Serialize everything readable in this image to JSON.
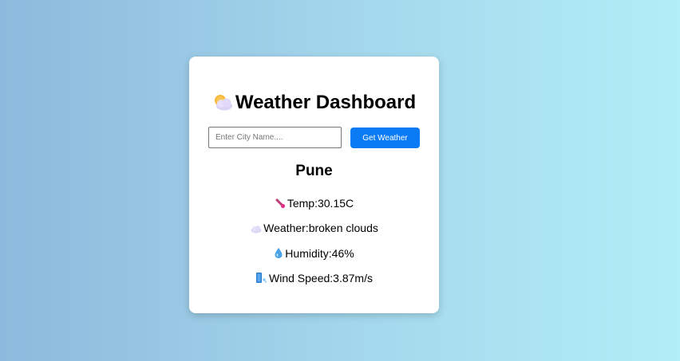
{
  "header": {
    "title": "Weather Dashboard",
    "icon": "sun-behind-cloud-icon"
  },
  "search": {
    "placeholder": "Enter City Name....",
    "value": "",
    "button_label": "Get Weather",
    "button_color": "#0a7af5"
  },
  "result": {
    "city": "Pune",
    "temp_label": "Temp:",
    "temp_value": "30.15C",
    "temp_icon": "thermometer-icon",
    "weather_label": "Weather:",
    "weather_value": "broken clouds",
    "weather_icon": "cloud-icon",
    "humidity_label": "Humidity:",
    "humidity_value": "46%",
    "humidity_icon": "droplet-icon",
    "wind_label": "Wind Speed:",
    "wind_value": "3.87m/s",
    "wind_icon": "wind-icon"
  },
  "colors": {
    "background_start": "#8db9dc",
    "background_end": "#b2eef7",
    "card": "#ffffff",
    "accent": "#0a7af5"
  }
}
